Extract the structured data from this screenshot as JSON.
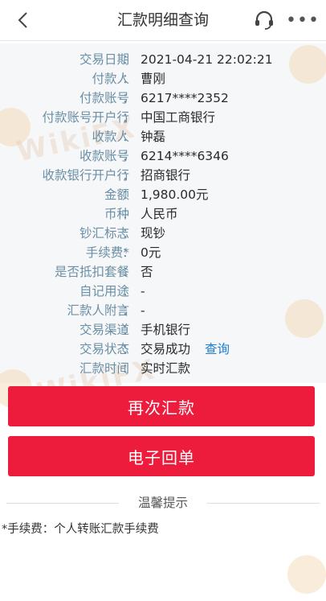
{
  "header": {
    "title": "汇款明细查询",
    "back_icon": "chevron-left-icon",
    "support_icon": "headset-icon",
    "more_icon": "more-dots-icon",
    "more_label": "•••"
  },
  "separator": "：",
  "details": [
    {
      "label": "交易日期",
      "value": "2021-04-21 22:02:21"
    },
    {
      "label": "付款人",
      "value": "曹刚"
    },
    {
      "label": "付款账号",
      "value": "6217****2352"
    },
    {
      "label": "付款账号开户行",
      "value": "中国工商银行"
    },
    {
      "label": "收款人",
      "value": "钟磊"
    },
    {
      "label": "收款账号",
      "value": "6214****6346"
    },
    {
      "label": "收款银行开户行",
      "value": "招商银行"
    },
    {
      "label": "金额",
      "value": "1,980.00元"
    },
    {
      "label": "币种",
      "value": "人民币"
    },
    {
      "label": "钞汇标志",
      "value": "现钞"
    },
    {
      "label": "手续费*",
      "value": "0元"
    },
    {
      "label": "是否抵扣套餐",
      "value": "否"
    },
    {
      "label": "自记用途",
      "value": "-"
    },
    {
      "label": "汇款人附言",
      "value": "-"
    },
    {
      "label": "交易渠道",
      "value": "手机银行"
    },
    {
      "label": "交易状态",
      "value": "交易成功"
    },
    {
      "label": "汇款时间",
      "value": "实时汇款"
    }
  ],
  "status_query_link": "查询",
  "buttons": {
    "remit_again": "再次汇款",
    "e_receipt": "电子回单"
  },
  "tips": {
    "title": "温馨提示",
    "text": "*手续费：个人转账汇款手续费"
  },
  "watermark_text": "WikiFX",
  "colors": {
    "label": "#6b8fa5",
    "value": "#2a2a2a",
    "link": "#1b7ed6",
    "primary_button": "#ee1c3c",
    "details_background": "#f6f7f9"
  }
}
